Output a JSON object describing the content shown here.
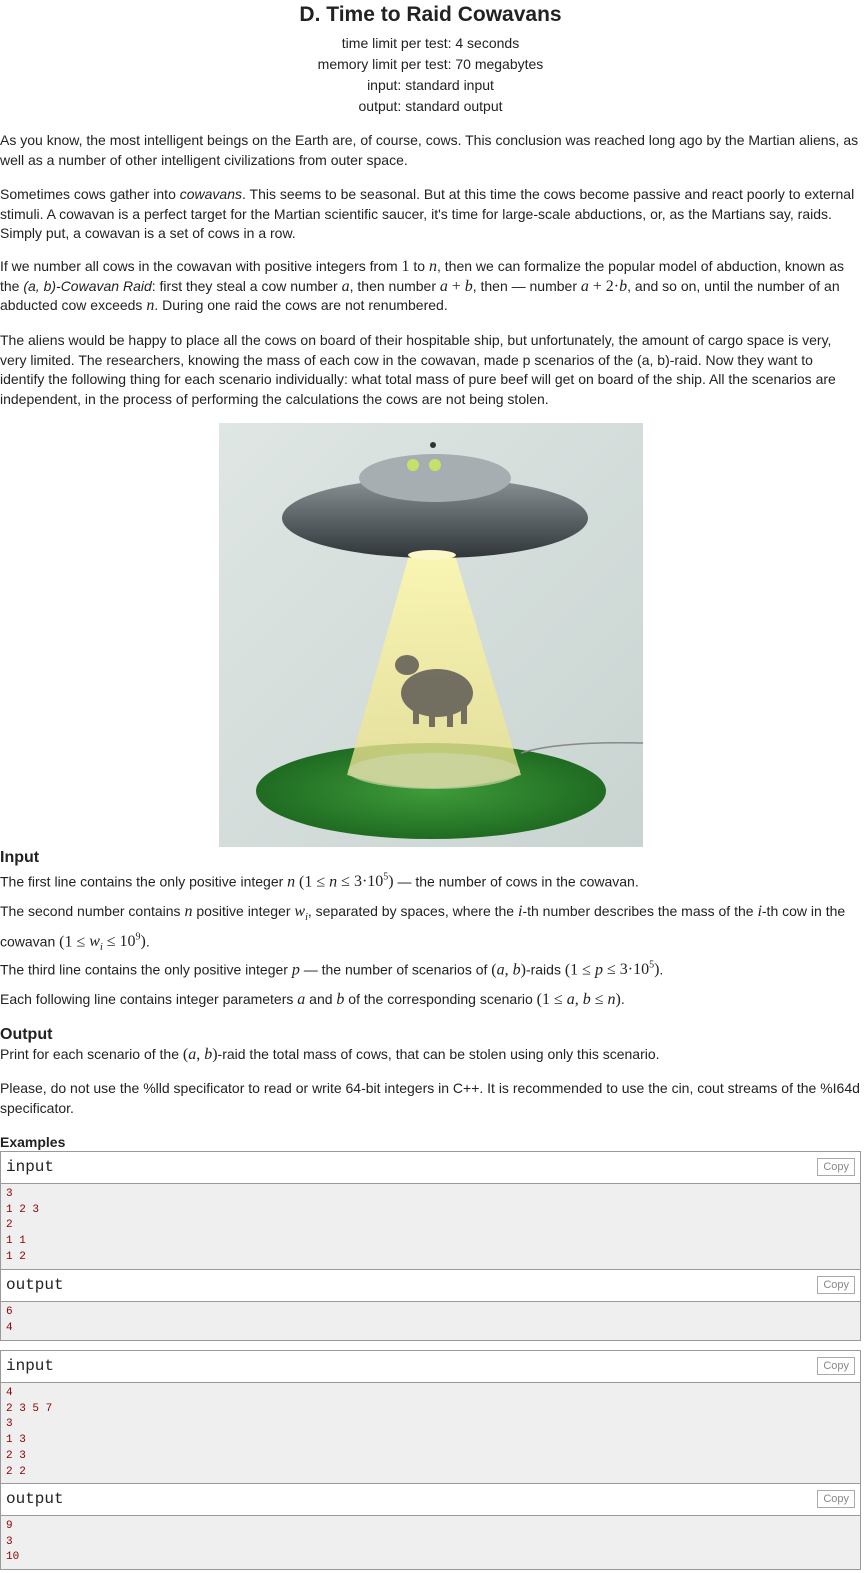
{
  "problem": {
    "title": "D. Time to Raid Cowavans",
    "time_limit": "time limit per test: 4 seconds",
    "memory_limit": "memory limit per test: 70 megabytes",
    "input": "input: standard input",
    "output": "output: standard output"
  },
  "statement": {
    "p1": "As you know, the most intelligent beings on the Earth are, of course, cows. This conclusion was reached long ago by the Martian aliens, as well as a number of other intelligent civilizations from outer space.",
    "p2a": "Sometimes cows gather into ",
    "p2b": "cowavans",
    "p2c": ". This seems to be seasonal. But at this time the cows become passive and react poorly to external stimuli. A cowavan is a perfect target for the Martian scientific saucer, it's time for large-scale abductions, or, as the Martians say, raids. Simply put, a cowavan is a set of cows in a row.",
    "p4": "The aliens would be happy to place all the cows on board of their hospitable ship, but unfortunately, the amount of cargo space is very, very limited. The researchers, knowing the mass of each cow in the cowavan, made p scenarios of the (a, b)-raid. Now they want to identify the following thing for each scenario individually: what total mass of pure beef will get on board of the ship. All the scenarios are independent, in the process of performing the calculations the cows are not being stolen."
  },
  "sections": {
    "input_title": "Input",
    "output_title": "Output",
    "examples_title": "Examples",
    "output_p2": "Please, do not use the %lld specificator to read or write 64-bit integers in C++. It is recommended to use the cin, cout streams of the %I64d specificator."
  },
  "examples": [
    {
      "input_label": "input",
      "input": "3\n1 2 3\n2\n1 1\n1 2",
      "output_label": "output",
      "output": "6\n4",
      "copy": "Copy"
    },
    {
      "input_label": "input",
      "input": "4\n2 3 5 7\n3\n1 3\n2 3\n2 2",
      "output_label": "output",
      "output": "9\n3\n10",
      "copy": "Copy"
    }
  ]
}
